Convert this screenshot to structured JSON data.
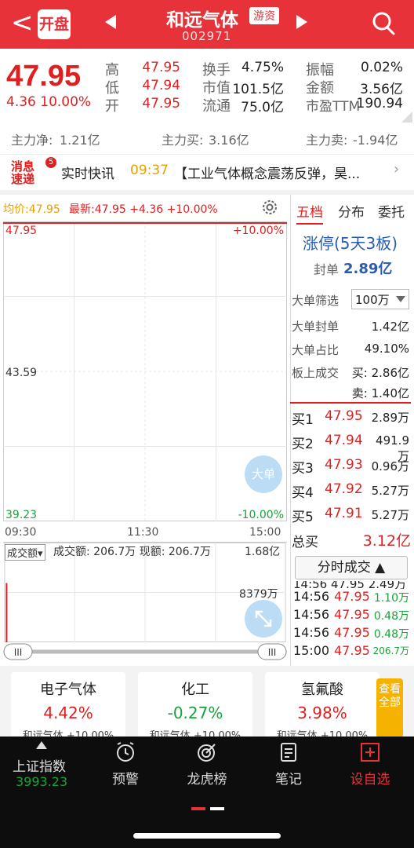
{
  "header": {
    "back": "<",
    "open_badge": "开盘",
    "stock_name": "和远气体",
    "stock_tag": "游资",
    "stock_code": "002971"
  },
  "quote": {
    "price": "47.95",
    "change": "4.36 10.00%",
    "high_label": "高",
    "high": "47.95",
    "low_label": "低",
    "low": "47.94",
    "open_label": "开",
    "open": "47.95",
    "turnover_label": "换手",
    "turnover": "4.75%",
    "mktcap_label": "市值",
    "mktcap": "101.5亿",
    "float_label": "流通",
    "float": "75.0亿",
    "amplitude_label": "振幅",
    "amplitude": "0.02%",
    "amount_label": "金额",
    "amount": "3.56亿",
    "pe_label": "市盈TTM",
    "pe": "190.94"
  },
  "fund": {
    "net_label": "主力净:",
    "net": "1.21亿",
    "buy_label": "主力买:",
    "buy": "3.16亿",
    "sell_label": "主力卖:",
    "sell": "-1.94亿"
  },
  "news": {
    "icon": "消息速递",
    "badge": "5",
    "title": "实时快讯",
    "time": "09:37",
    "text": "【工业气体概念震荡反弹，昊..."
  },
  "chart_header": {
    "avg": "均价:47.95",
    "latest": "最新:47.95 +4.36 +10.00%"
  },
  "chart_data": {
    "type": "line",
    "y_ticks_left": [
      "47.95",
      "43.59",
      "39.23"
    ],
    "y_ticks_right": [
      "+10.00%",
      "-10.00%"
    ],
    "x": [
      "09:30",
      "11:30",
      "15:00"
    ],
    "ylim": [
      39.23,
      47.95
    ],
    "series": [
      {
        "values": [
          47.95
        ]
      }
    ]
  },
  "volume": {
    "select": "成交额▾",
    "info": "成交额: 206.7万 现额: 206.7万",
    "max": "1.68亿",
    "mid": "8379万"
  },
  "floating": {
    "big_order": "大单"
  },
  "right_panel": {
    "tabs": [
      "五档",
      "分布",
      "委托"
    ],
    "limit_title": "涨停(5天3板)",
    "seal_label": "封单",
    "seal_val": "2.89亿",
    "filter_label": "大单筛选",
    "filter_val": "100万",
    "big_seal_label": "大单封单",
    "big_seal_val": "1.42亿",
    "big_ratio_label": "大单占比",
    "big_ratio_val": "49.10%",
    "board_trade_label": "板上成交",
    "board_buy": "买: 2.86亿",
    "board_sell": "卖: 1.40亿",
    "levels": [
      {
        "label": "买1",
        "price": "47.95",
        "vol": "2.89万"
      },
      {
        "label": "买2",
        "price": "47.94",
        "vol": "491.9万"
      },
      {
        "label": "买3",
        "price": "47.93",
        "vol": "0.96万"
      },
      {
        "label": "买4",
        "price": "47.92",
        "vol": "5.27万"
      },
      {
        "label": "买5",
        "price": "47.91",
        "vol": "5.27万"
      }
    ],
    "total_buy_label": "总买",
    "total_buy": "3.12亿",
    "tick_btn": "分时成交 ▲",
    "ticks": [
      {
        "t": "14:56",
        "p": "47.95",
        "v": "1.10万"
      },
      {
        "t": "14:56",
        "p": "47.95",
        "v": "0.48万"
      },
      {
        "t": "14:56",
        "p": "47.95",
        "v": "0.48万"
      },
      {
        "t": "15:00",
        "p": "47.95",
        "v": "206.7万"
      }
    ]
  },
  "cards": [
    {
      "name": "电子气体",
      "pct": "4.42%",
      "sub": "和远气体 +10.00%"
    },
    {
      "name": "化工",
      "pct": "-0.27%",
      "sub": "和远气体 +10.00%"
    },
    {
      "name": "氢氟酸",
      "pct": "3.98%",
      "sub": "和远气体 +10.00%"
    }
  ],
  "see_all": "查看全部",
  "bottom_bar": {
    "index_name": "上证指数",
    "index_val": "3993.23",
    "items": [
      "预警",
      "龙虎榜",
      "笔记",
      "设自选"
    ]
  },
  "colors": {
    "up": "#e02020",
    "down": "#17a33a",
    "header": "#e8323a"
  }
}
